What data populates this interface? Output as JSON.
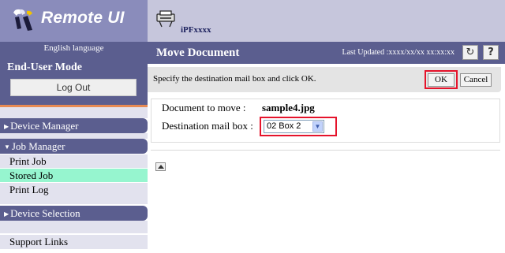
{
  "app": {
    "logo_text": "Remote UI",
    "language": "English language",
    "mode_label": "End-User Mode",
    "logout_label": "Log Out"
  },
  "nav": {
    "device_manager": "Device Manager",
    "job_manager": "Job Manager",
    "job_items": [
      {
        "label": "Print Job",
        "active": false
      },
      {
        "label": "Stored Job",
        "active": true
      },
      {
        "label": "Print Log",
        "active": false
      }
    ],
    "device_selection": "Device Selection",
    "support_links": "Support Links"
  },
  "header": {
    "printer_name": "iPFxxxx",
    "page_title": "Move Document",
    "last_updated": "Last Updated :xxxx/xx/xx xx:xx:xx",
    "refresh_icon": "refresh-icon",
    "help_label": "?"
  },
  "instructions": {
    "text": "Specify the destination mail box and click OK.",
    "ok_label": "OK",
    "cancel_label": "Cancel"
  },
  "form": {
    "doc_label": "Document to move :",
    "doc_value": "sample4.jpg",
    "dest_label": "Destination mail box :",
    "dest_value": "02 Box 2"
  },
  "colors": {
    "nav_dark": "#5b5e8f",
    "logo_bg": "#8a8cbb",
    "header_bg": "#c6c6dc",
    "active_item": "#96f5cf",
    "highlight": "#e5132b",
    "accent_line": "#e78a53"
  }
}
